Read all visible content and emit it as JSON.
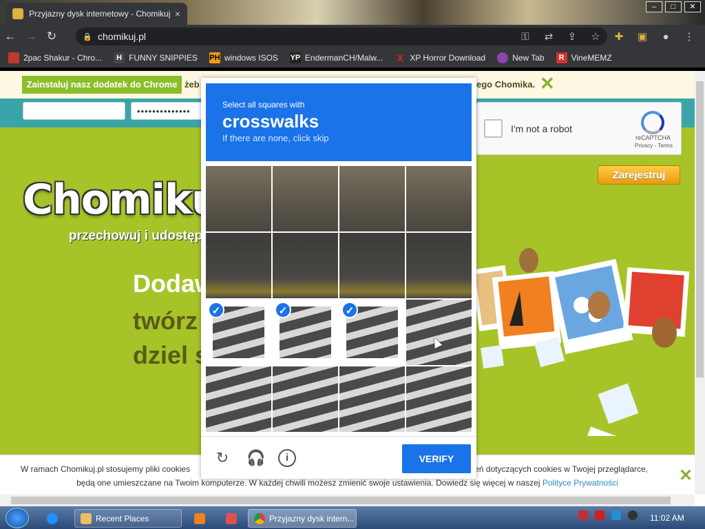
{
  "browser": {
    "tab_title": "Przyjazny dysk internetowy - Chomikuj.pl",
    "tab_close": "×",
    "url": "chomikuj.pl",
    "nav": {
      "back": "←",
      "forward": "→",
      "reload": "↻"
    },
    "toolbar_icons": [
      "key-icon",
      "translate-icon",
      "share-icon",
      "star-icon",
      "extensions-icon",
      "sidebar-icon",
      "profile-icon",
      "menu-icon"
    ],
    "window_controls": {
      "minimize": "–",
      "maximize": "□",
      "close": "✕"
    }
  },
  "bookmarks": [
    {
      "label": "2pac Shakur - Chro...",
      "icon": "tupac-icon",
      "color": "#c0392b"
    },
    {
      "label": "FUNNY SNIPPIES",
      "icon": "h-icon",
      "color": "#444444"
    },
    {
      "label": "windows ISOS",
      "icon": "ph-icon",
      "color": "#f39c12"
    },
    {
      "label": "EndermanCH/Malw...",
      "icon": "yp-icon",
      "color": "#222222"
    },
    {
      "label": "XP Horror Download",
      "icon": "x-icon",
      "color": "#e62117"
    },
    {
      "label": "New Tab",
      "icon": "globe-icon",
      "color": "#8e44ad"
    },
    {
      "label": "VineMEMZ",
      "icon": "r-icon",
      "color": "#d32f2f"
    }
  ],
  "page": {
    "addon_button": "Zainstaluj nasz dodatek do Chrome",
    "addon_text_start": "żeb",
    "addon_text_end": "ego Chomika.",
    "login": {
      "password": "••••••••••••••"
    },
    "register": "Zarejestruj",
    "logo": "Chomikuj.",
    "tagline": "przechowuj i udostępni",
    "promo": [
      "Dodaw",
      "twórz",
      "dziel s"
    ]
  },
  "recaptcha_box": {
    "label": "I'm not a robot",
    "brand": "reCAPTCHA",
    "links": "Privacy - Terms"
  },
  "challenge": {
    "instruction": "Select all squares with",
    "target": "crosswalks",
    "hint": "If there are none, click skip",
    "selected_tiles": [
      8,
      9,
      10
    ],
    "verify": "VERIFY",
    "footer_icons": [
      "reload-icon",
      "audio-icon",
      "info-icon"
    ]
  },
  "cookie": {
    "line1_start": "W ramach Chomikuj.pl stosujemy pliki cookies",
    "line1_end": "awień dotyczących cookies w Twojej przeglądarce,",
    "line2": "będą one umieszczane na Twoim komputerze. W każdej chwili możesz zmienić swoje ustawienia. Dowiedz się więcej w naszej",
    "link": "Polityce Prywatności",
    "close": "✕"
  },
  "taskbar": {
    "items": [
      {
        "label": "Recent Places",
        "icon": "folder-icon"
      },
      {
        "label": "Przyjazny dysk intern...",
        "icon": "chrome-icon"
      }
    ],
    "clock": "11:02 AM"
  }
}
